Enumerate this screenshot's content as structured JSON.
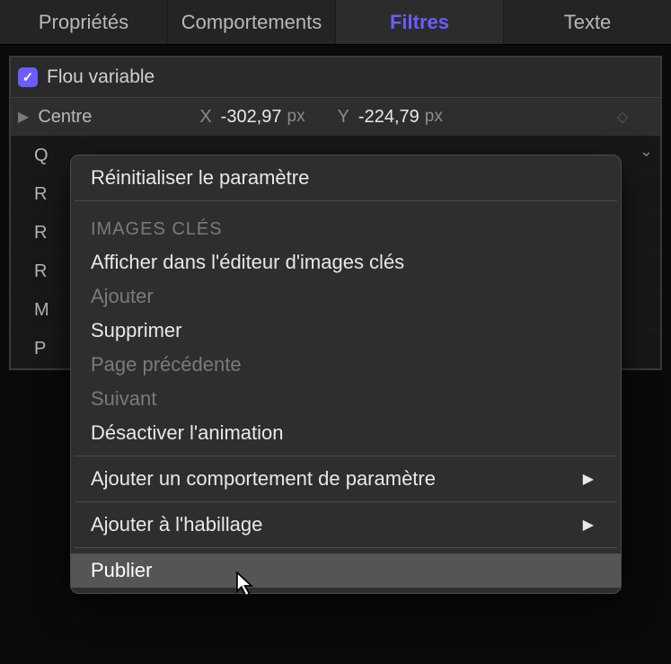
{
  "tabs": {
    "properties": "Propriétés",
    "behaviors": "Comportements",
    "filters": "Filtres",
    "text": "Texte"
  },
  "filter": {
    "name": "Flou variable"
  },
  "params": {
    "center": {
      "label": "Centre",
      "x_label": "X",
      "x_value": "-302,97",
      "x_unit": "px",
      "y_label": "Y",
      "y_value": "-224,79",
      "y_unit": "px"
    },
    "rows": [
      "Q",
      "R",
      "R",
      "R",
      "M",
      "P"
    ]
  },
  "menu": {
    "reset": "Réinitialiser le paramètre",
    "keyframes_header": "IMAGES CLÉS",
    "show_editor": "Afficher dans l'éditeur d'images clés",
    "add": "Ajouter",
    "delete": "Supprimer",
    "previous": "Page précédente",
    "next": "Suivant",
    "disable_anim": "Désactiver l'animation",
    "add_behavior": "Ajouter un comportement de paramètre",
    "add_to_rig": "Ajouter à l'habillage",
    "publish": "Publier"
  }
}
